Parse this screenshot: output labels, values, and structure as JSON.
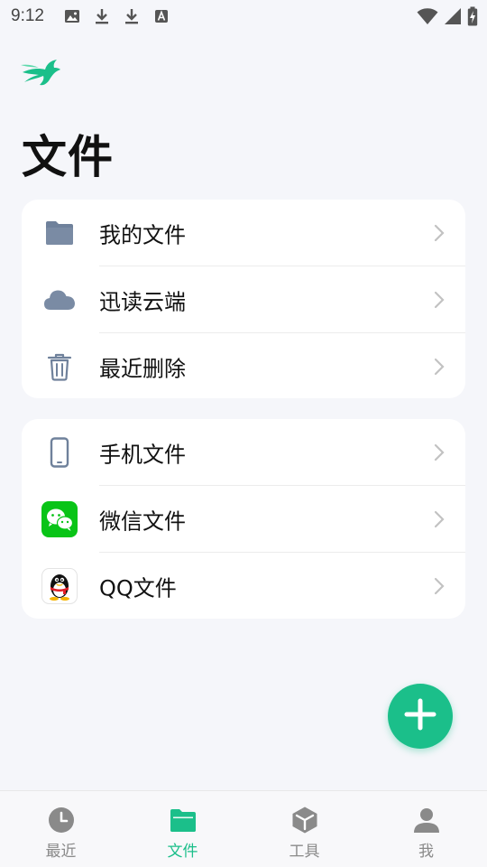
{
  "status_bar": {
    "time": "9:12",
    "icons": [
      "image-icon",
      "download-icon",
      "download-icon",
      "font-icon"
    ],
    "right_icons": [
      "wifi-icon",
      "signal-icon",
      "battery-charging-icon"
    ]
  },
  "header": {
    "title": "文件"
  },
  "storage_group": {
    "items": [
      {
        "label": "我的文件",
        "icon": "folder-icon"
      },
      {
        "label": "迅读云端",
        "icon": "cloud-icon"
      },
      {
        "label": "最近删除",
        "icon": "trash-icon"
      }
    ]
  },
  "source_group": {
    "items": [
      {
        "label": "手机文件",
        "icon": "phone-icon"
      },
      {
        "label": "微信文件",
        "icon": "wechat-icon"
      },
      {
        "label": "QQ文件",
        "icon": "qq-icon"
      }
    ]
  },
  "bottom_nav": {
    "items": [
      {
        "label": "最近",
        "icon": "clock-icon",
        "active": false
      },
      {
        "label": "文件",
        "icon": "folder-icon",
        "active": true
      },
      {
        "label": "工具",
        "icon": "cube-icon",
        "active": false
      },
      {
        "label": "我",
        "icon": "person-icon",
        "active": false
      }
    ]
  },
  "colors": {
    "accent": "#1bbf8a",
    "background": "#f5f6fa",
    "card": "#ffffff",
    "icon_blue_gray": "#6f819b",
    "inactive": "#8a8a8a"
  }
}
